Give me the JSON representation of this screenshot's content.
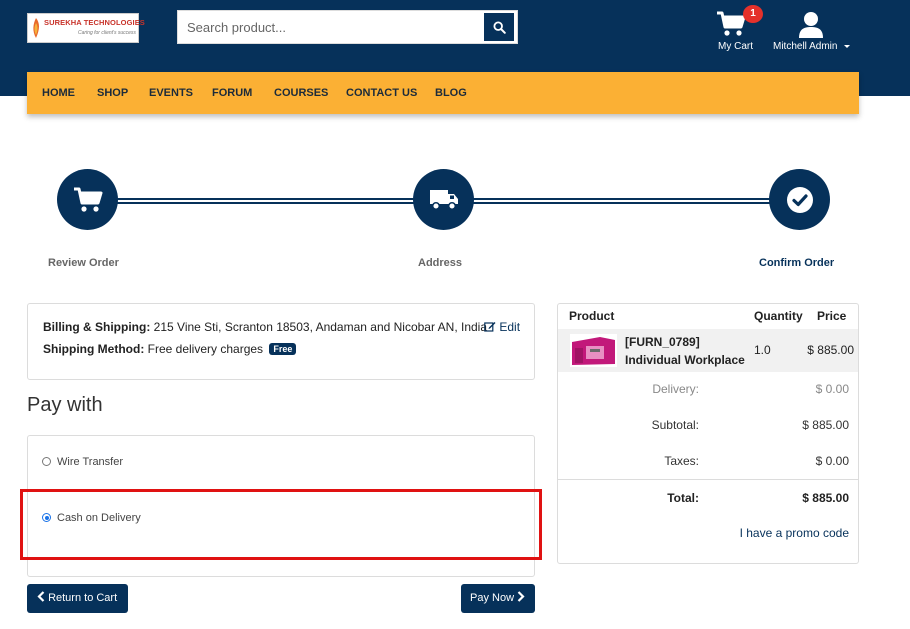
{
  "header": {
    "logo": {
      "company": "SUREKHA TECHNOLOGIES",
      "tagline": "Caring for client's success"
    },
    "search": {
      "placeholder": "Search product...",
      "value": ""
    },
    "cart": {
      "count": "1",
      "label": "My Cart"
    },
    "user": {
      "name": "Mitchell Admin"
    }
  },
  "nav": {
    "items": [
      "HOME",
      "SHOP",
      "EVENTS",
      "FORUM",
      "COURSES",
      "CONTACT US",
      "BLOG"
    ]
  },
  "progress": {
    "steps": [
      {
        "label": "Review Order",
        "icon": "cart-icon",
        "active": false
      },
      {
        "label": "Address",
        "icon": "truck-icon",
        "active": false
      },
      {
        "label": "Confirm Order",
        "icon": "check-circle-icon",
        "active": true
      }
    ]
  },
  "address": {
    "billing_label": "Billing & Shipping:",
    "billing_value": "215 Vine Sti, Scranton 18503, Andaman and Nicobar AN, India",
    "edit_label": "Edit",
    "shipping_label": "Shipping Method:",
    "shipping_value": "Free delivery charges",
    "shipping_badge": "Free"
  },
  "payment": {
    "title": "Pay with",
    "options": [
      {
        "label": "Wire Transfer",
        "selected": false
      },
      {
        "label": "Cash on Delivery",
        "selected": true
      }
    ],
    "return_label": "Return to Cart",
    "pay_label": "Pay Now"
  },
  "summary": {
    "headers": {
      "product": "Product",
      "quantity": "Quantity",
      "price": "Price"
    },
    "items": [
      {
        "code": "[FURN_0789]",
        "name": "Individual Workplace",
        "quantity": "1.0",
        "price": "$ 885.00"
      }
    ],
    "delivery_label": "Delivery:",
    "delivery_value": "$ 0.00",
    "subtotal_label": "Subtotal:",
    "subtotal_value": "$ 885.00",
    "taxes_label": "Taxes:",
    "taxes_value": "$ 0.00",
    "total_label": "Total:",
    "total_value": "$ 885.00",
    "promo_label": "I have a promo code"
  },
  "colors": {
    "primary": "#06315a",
    "accent": "#fbb034",
    "badge": "#e4312b",
    "highlight": "#e01212"
  }
}
